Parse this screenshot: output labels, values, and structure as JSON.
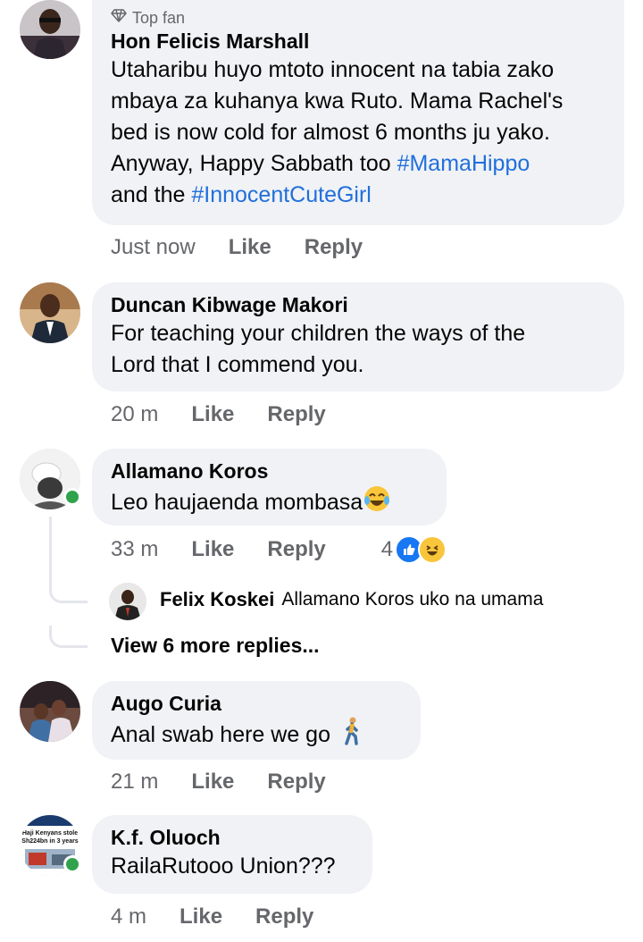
{
  "comments": [
    {
      "badge": "Top fan",
      "author": "Hon Felicis Marshall",
      "lines": [
        "Utaharibu huyo mtoto innocent na tabia zako",
        "mbaya za kuhanya kwa Ruto. Mama Rachel's",
        "bed is now cold for almost 6 months ju yako.",
        "Anyway, Happy Sabbath too ",
        "and the "
      ],
      "hashtags": [
        "#MamaHippo",
        "#InnocentCuteGirl"
      ],
      "time": "Just now",
      "like": "Like",
      "reply": "Reply"
    },
    {
      "author": "Duncan Kibwage Makori",
      "lines": [
        "For teaching your children the ways of the",
        "Lord that I commend you."
      ],
      "time": "20 m",
      "like": "Like",
      "reply": "Reply"
    },
    {
      "author": "Allamano Koros",
      "text": "Leo haujaenda mombasa",
      "time": "33 m",
      "like": "Like",
      "reply": "Reply",
      "reaction_count": "4",
      "reply_preview": {
        "author": "Felix Koskei",
        "text": "Allamano Koros uko na umama"
      },
      "view_more": "View 6 more replies..."
    },
    {
      "author": "Augo Curia",
      "text": "Anal swab here we go",
      "time": "21 m",
      "like": "Like",
      "reply": "Reply"
    },
    {
      "author": "K.f. Oluoch",
      "text": "RailaRutooo Union???",
      "time": "4 m",
      "like": "Like",
      "reply": "Reply",
      "avatar_text": [
        "Haji Kenyans stole",
        "Sh224bn in 3 years"
      ]
    }
  ],
  "colors": {
    "bubble": "#f0f2f5",
    "hashtag": "#216fdb",
    "meta": "#65676b",
    "online": "#31a24c",
    "like_blue": "#1877f2"
  },
  "icons": [
    "diamond-icon",
    "like-reaction-icon",
    "laugh-reaction-icon",
    "laugh-cry-emoji",
    "walking-person-emoji"
  ]
}
